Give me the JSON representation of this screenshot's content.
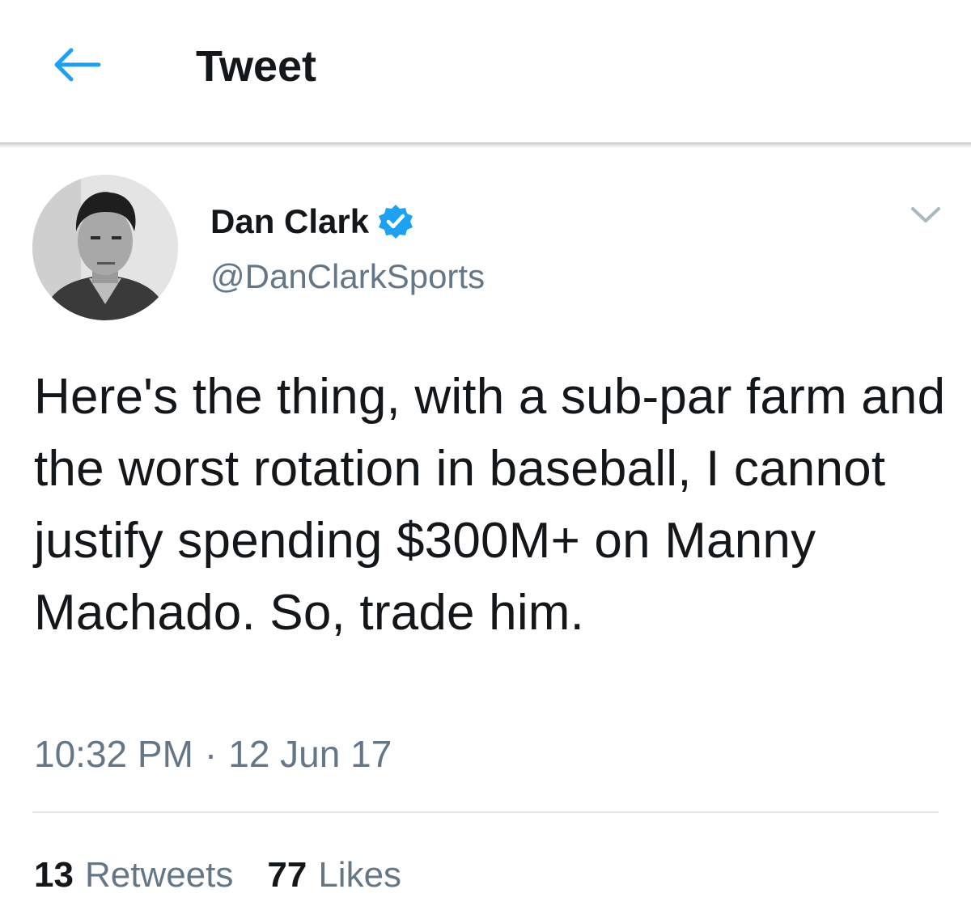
{
  "colors": {
    "accent": "#1da1f2",
    "text_primary": "#14171a",
    "text_secondary": "#657786",
    "divider": "#e1e8ed"
  },
  "header": {
    "back_icon": "arrow-left-icon",
    "title": "Tweet"
  },
  "tweet": {
    "author": {
      "display_name": "Dan Clark",
      "verified_icon": "verified-badge-icon",
      "handle": "@DanClarkSports",
      "avatar_icon": "user-avatar"
    },
    "menu_icon": "chevron-down-icon",
    "text": "Here's the thing, with a sub-par farm and the worst rotation in baseball, I cannot justify spending $300M+ on Manny Machado. So, trade him.",
    "time": "10:32 PM",
    "separator": "·",
    "date": "12 Jun 17",
    "stats": {
      "retweets_count": "13",
      "retweets_label": "Retweets",
      "likes_count": "77",
      "likes_label": "Likes"
    }
  }
}
